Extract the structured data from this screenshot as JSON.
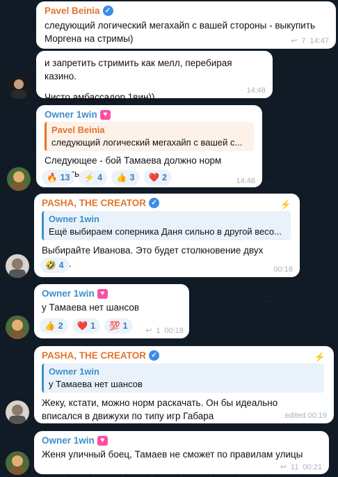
{
  "messages": [
    {
      "sender": "Pavel Beinia",
      "text": "следующий логический мегахайп с вашей стороны - выкупить Моргена на стримы)",
      "forwards": "7",
      "time": "14:47"
    },
    {
      "text1": "и запретить стримить как мелл, перебирая казино.",
      "text2": "Чисто амбассадор 1вин))",
      "time": "14:48"
    },
    {
      "sender": "Owner 1win",
      "reply_sender": "Pavel Beinia",
      "reply_text": "следующий логический мегахайп с вашей с...",
      "text": "Следующее - бой Тамаева должно норм собрать",
      "time": "14:48",
      "reactions": [
        {
          "emoji": "🔥",
          "count": "13"
        },
        {
          "emoji": "⚡",
          "count": "4"
        },
        {
          "emoji": "👍",
          "count": "3"
        },
        {
          "emoji": "❤️",
          "count": "2"
        }
      ]
    },
    {
      "sender": "PASHA, THE CREATOR",
      "reply_sender": "Owner 1win",
      "reply_text": "Ещё выбираем соперника Даня сильно в другой весо...",
      "text": "Выбирайте Иванова. Это будет столкновение двух миров.",
      "time": "00:18",
      "reactions": [
        {
          "emoji": "🤣",
          "count": "4"
        }
      ]
    },
    {
      "sender": "Owner 1win",
      "text": "у Тамаева нет шансов",
      "forwards": "1",
      "time": "00:18",
      "reactions": [
        {
          "emoji": "👍",
          "count": "2"
        },
        {
          "emoji": "❤️",
          "count": "1"
        },
        {
          "emoji": "💯",
          "count": "1"
        }
      ]
    },
    {
      "sender": "PASHA, THE CREATOR",
      "reply_sender": "Owner 1win",
      "reply_text": "у Тамаева нет шансов",
      "text": "Жеку, кстати, можно норм раскачать. Он бы идеально вписался в движухи по типу игр Габара",
      "time": "edited 00:19"
    },
    {
      "sender": "Owner 1win",
      "text": "Женя уличный боец, Тамаев не сможет по правилам улицы",
      "forwards": "11",
      "time": "00:21"
    }
  ],
  "icons": {
    "verified": "verified-check-icon",
    "heart": "heart-badge-icon",
    "forward": "forward-arrow-icon",
    "bolt": "lightning-bolt-icon"
  }
}
